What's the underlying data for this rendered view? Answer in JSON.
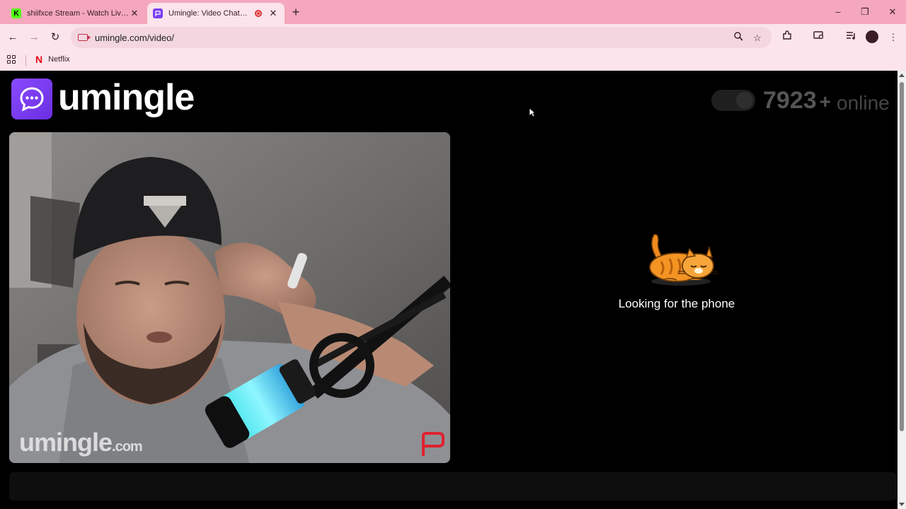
{
  "browser": {
    "tabs": [
      {
        "title": "shiifxce Stream - Watch Live on",
        "favicon": "kick-icon",
        "active": false
      },
      {
        "title": "Umingle: Video Chat with St",
        "favicon": "umingle-chat-icon",
        "active": true
      }
    ],
    "address": "umingle.com/video/",
    "bookmarks": [
      {
        "label": "Netflix",
        "icon": "netflix-icon"
      }
    ]
  },
  "site": {
    "brand": "umingle",
    "online_count": "7923",
    "online_plus": "+",
    "online_label": "online",
    "status_text": "Looking for the phone",
    "watermark": "umingle",
    "watermark_suffix": ".com"
  },
  "colors": {
    "tab_strip": "#f4a7bd",
    "toolbar": "#fbe4ec",
    "brand_purple": "#7b3ff2",
    "page_bg": "#000000"
  }
}
